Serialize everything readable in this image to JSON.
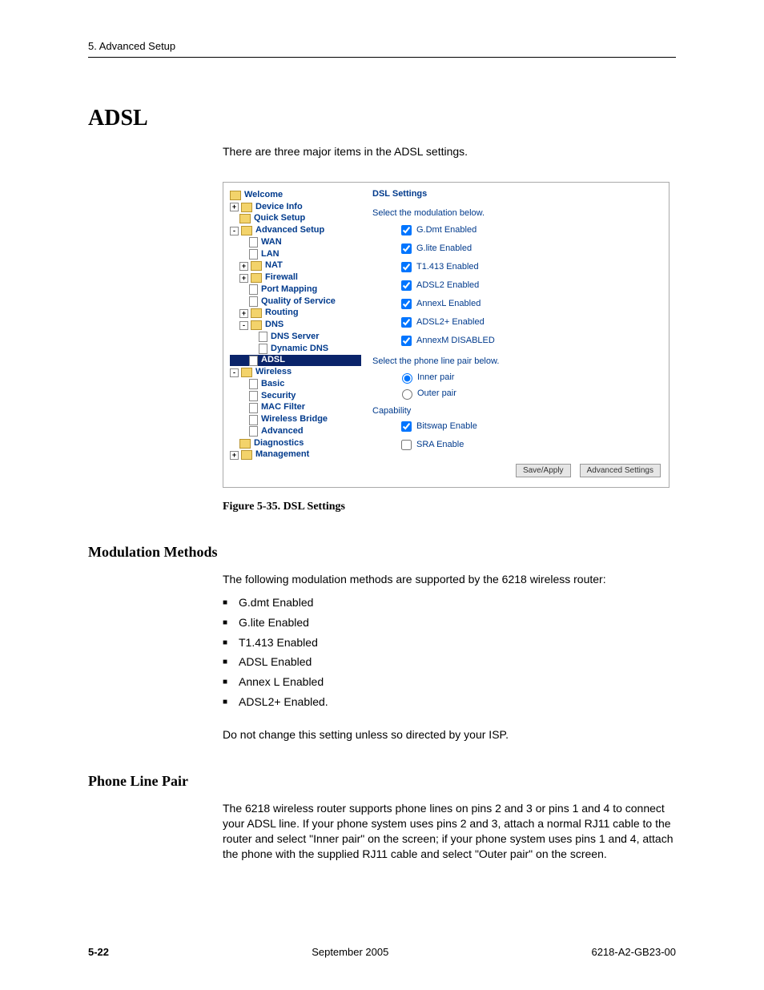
{
  "chapter_header": "5. Advanced Setup",
  "section_title": "ADSL",
  "intro_para": "There are three major items in the ADSL settings.",
  "figure_caption": "Figure 5-35.   DSL Settings",
  "nav": {
    "Welcome": "Welcome",
    "DeviceInfo": "Device Info",
    "QuickSetup": "Quick Setup",
    "AdvancedSetup": "Advanced Setup",
    "WAN": "WAN",
    "LAN": "LAN",
    "NAT": "NAT",
    "Firewall": "Firewall",
    "PortMapping": "Port Mapping",
    "QoS": "Quality of Service",
    "Routing": "Routing",
    "DNS": "DNS",
    "DNSServer": "DNS Server",
    "DynamicDNS": "Dynamic DNS",
    "ADSL": "ADSL",
    "Wireless": "Wireless",
    "Basic": "Basic",
    "Security": "Security",
    "MACFilter": "MAC Filter",
    "WirelessBridge": "Wireless Bridge",
    "Advanced": "Advanced",
    "Diagnostics": "Diagnostics",
    "Management": "Management"
  },
  "panel": {
    "title": "DSL Settings",
    "modulation_prompt": "Select the modulation below.",
    "opts": {
      "gdmt": {
        "label": "G.Dmt Enabled",
        "checked": true
      },
      "glite": {
        "label": "G.lite Enabled",
        "checked": true
      },
      "t1413": {
        "label": "T1.413 Enabled",
        "checked": true
      },
      "adsl2": {
        "label": "ADSL2 Enabled",
        "checked": true
      },
      "annexl": {
        "label": "AnnexL Enabled",
        "checked": true
      },
      "adsl2p": {
        "label": "ADSL2+ Enabled",
        "checked": true
      },
      "annexm": {
        "label": "AnnexM DISABLED",
        "checked": true
      }
    },
    "pair_prompt": "Select the phone line pair below.",
    "pairs": {
      "inner": {
        "label": "Inner pair",
        "selected": true
      },
      "outer": {
        "label": "Outer pair",
        "selected": false
      }
    },
    "cap_title": "Capability",
    "caps": {
      "bitswap": {
        "label": "Bitswap Enable",
        "checked": true
      },
      "sra": {
        "label": "SRA Enable",
        "checked": false
      }
    },
    "btn_save": "Save/Apply",
    "btn_adv": "Advanced Settings"
  },
  "modulation": {
    "heading": "Modulation Methods",
    "intro": "The following modulation methods are supported by the 6218 wireless router:",
    "items": [
      "G.dmt Enabled",
      "G.lite Enabled",
      "T1.413 Enabled",
      "ADSL Enabled",
      "Annex L Enabled",
      "ADSL2+ Enabled."
    ],
    "note": "Do not change this setting unless so directed by your ISP."
  },
  "phoneline": {
    "heading": "Phone Line Pair",
    "para": "The 6218 wireless router supports phone lines on pins 2 and 3 or pins 1 and 4 to connect your ADSL line. If your phone system uses pins 2 and 3, attach a normal RJ11 cable to the router and select \"Inner pair\" on the screen; if your phone system uses pins 1 and 4, attach the phone with the supplied RJ11 cable and select \"Outer pair\" on the screen."
  },
  "footer": {
    "page": "5-22",
    "date": "September 2005",
    "doc": "6218-A2-GB23-00"
  }
}
